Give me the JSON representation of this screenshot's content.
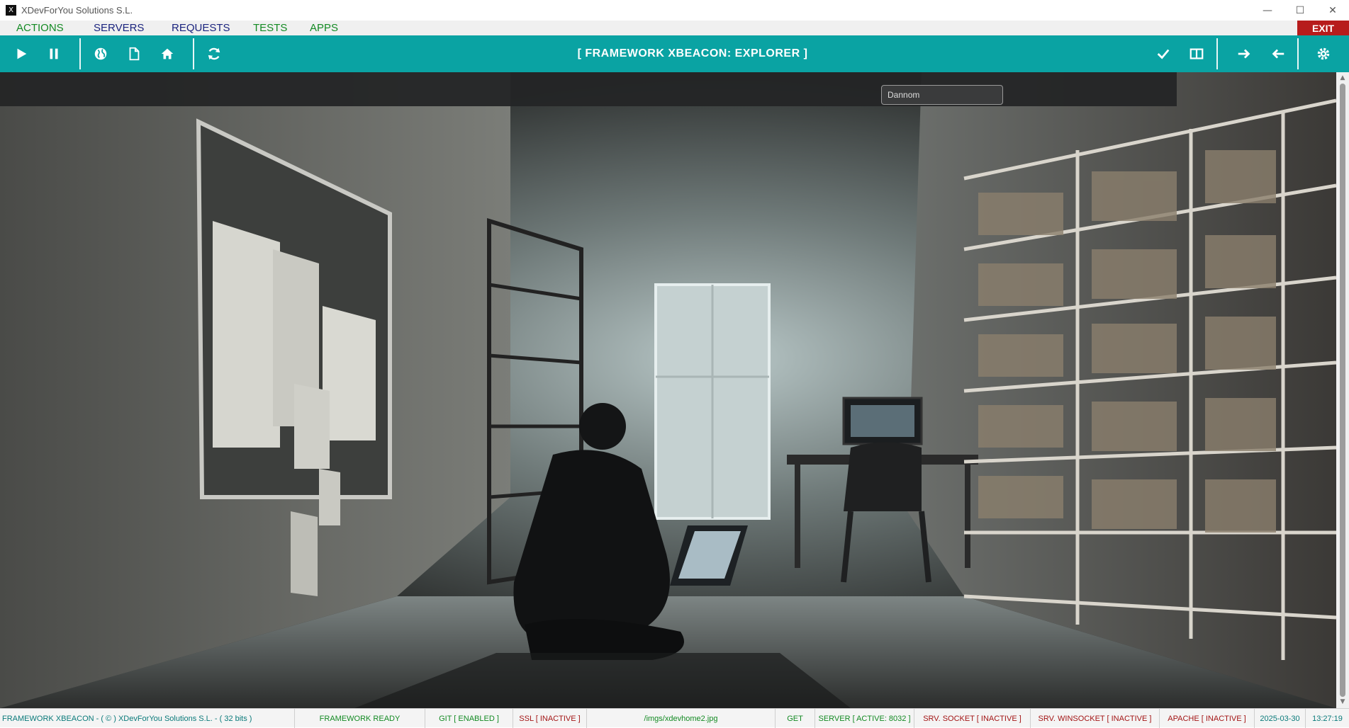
{
  "window": {
    "title": "XDevForYou Solutions S.L.",
    "app_icon_glyph": "X",
    "controls": [
      "minimize-icon",
      "maximize-icon",
      "close-icon"
    ]
  },
  "menu": {
    "items": [
      {
        "label": "ACTIONS",
        "color": "#138a23"
      },
      {
        "label": "SERVERS",
        "color": "#1a237e"
      },
      {
        "label": "REQUESTS",
        "color": "#1a237e"
      },
      {
        "label": "TESTS",
        "color": "#138a23"
      },
      {
        "label": "APPS",
        "color": "#138a23"
      }
    ],
    "exit_label": "EXIT"
  },
  "toolbar": {
    "title": "[ FRAMEWORK XBEACON: EXPLORER ]",
    "accent": "#0aa3a3",
    "left_buttons": [
      "play-icon",
      "pause-icon",
      "globe-icon",
      "document-icon",
      "home-icon",
      "refresh-icon"
    ],
    "right_buttons": [
      "check-icon",
      "split-view-icon",
      "arrow-right-icon",
      "arrow-left-icon",
      "gear-icon"
    ]
  },
  "content": {
    "image_path": "/imgs/xdevhome2.jpg",
    "embedded_search_text": "Dannom"
  },
  "status": {
    "app_info": "FRAMEWORK XBEACON -  ( © ) XDevForYou Solutions S.L.  - ( 32 bits )",
    "ready": "FRAMEWORK READY",
    "git": "GIT [ ENABLED ]",
    "ssl": "SSL [ INACTIVE ]",
    "path": "/imgs/xdevhome2.jpg",
    "method": "GET",
    "server": "SERVER [ ACTIVE: 8032 ]",
    "socket": "SRV. SOCKET [ INACTIVE ]",
    "winsocket": "SRV. WINSOCKET [ INACTIVE ]",
    "apache": "APACHE [ INACTIVE ]",
    "date": "2025-03-30",
    "time": "13:27:19"
  }
}
